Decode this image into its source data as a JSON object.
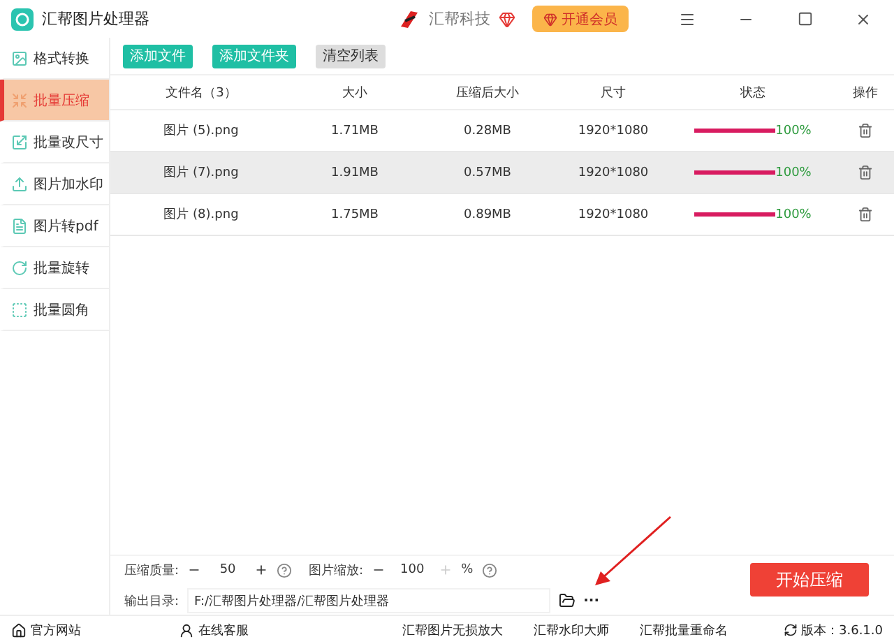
{
  "window": {
    "title": "汇帮图片处理器",
    "brand": "汇帮科技",
    "vip_button": "开通会员"
  },
  "sidebar": {
    "items": [
      {
        "label": "格式转换",
        "selected": false
      },
      {
        "label": "批量压缩",
        "selected": true
      },
      {
        "label": "批量改尺寸",
        "selected": false
      },
      {
        "label": "图片加水印",
        "selected": false
      },
      {
        "label": "图片转pdf",
        "selected": false
      },
      {
        "label": "批量旋转",
        "selected": false
      },
      {
        "label": "批量圆角",
        "selected": false
      }
    ]
  },
  "toolbar": {
    "buttons": [
      {
        "label": "添加文件",
        "kind": "primary"
      },
      {
        "label": "添加文件夹",
        "kind": "primary"
      },
      {
        "label": "清空列表",
        "kind": "secondary"
      }
    ]
  },
  "table": {
    "columns": [
      "文件名（3）",
      "大小",
      "压缩后大小",
      "尺寸",
      "状态",
      "操作"
    ],
    "rows": [
      {
        "name": "图片 (5).png",
        "size": "1.71MB",
        "compressed": "0.28MB",
        "dims": "1920*1080",
        "level": 1,
        "reading": "100%",
        "selected": false
      },
      {
        "name": "图片 (7).png",
        "size": "1.91MB",
        "compressed": "0.57MB",
        "dims": "1920*1080",
        "level": 1,
        "reading": "100%",
        "selected": true
      },
      {
        "name": "图片 (8).png",
        "size": "1.75MB",
        "compressed": "0.89MB",
        "dims": "1920*1080",
        "level": 1,
        "reading": "100%",
        "selected": false
      }
    ]
  },
  "settings": {
    "quality_label": "压缩质量:",
    "quality": "50",
    "scale_label": "图片缩放:",
    "scale": "100",
    "scale_unit": "%",
    "output_label": "输出目录:",
    "output_path": "F:/汇帮图片处理器/汇帮图片处理器",
    "more": "···",
    "start_button": "开始压缩"
  },
  "status_bar": {
    "left": [
      "官方网站",
      "在线客服"
    ],
    "links": [
      "汇帮图片无损放大",
      "汇帮水印大师",
      "汇帮批量重命名"
    ],
    "version": "版本：3.6.1.0"
  }
}
